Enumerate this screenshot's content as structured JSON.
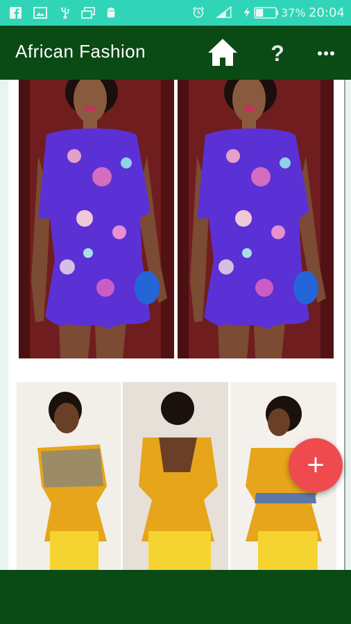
{
  "status_bar": {
    "battery_percent": "37%",
    "time": "20:04",
    "color": "#30d5b7"
  },
  "app_bar": {
    "title": "African Fashion",
    "help_label": "?",
    "color": "#0a4a14"
  },
  "icons": {
    "home": "home-icon",
    "help": "help-icon",
    "overflow": "more-vert-icon",
    "fab": "plus-icon"
  },
  "fab": {
    "label": "+",
    "color": "#ef4b4f"
  },
  "gallery": {
    "items": [
      {
        "subject": "purple floral dress (left)"
      },
      {
        "subject": "purple floral dress (right)"
      },
      {
        "subject": "yellow peplum outfit"
      }
    ]
  }
}
